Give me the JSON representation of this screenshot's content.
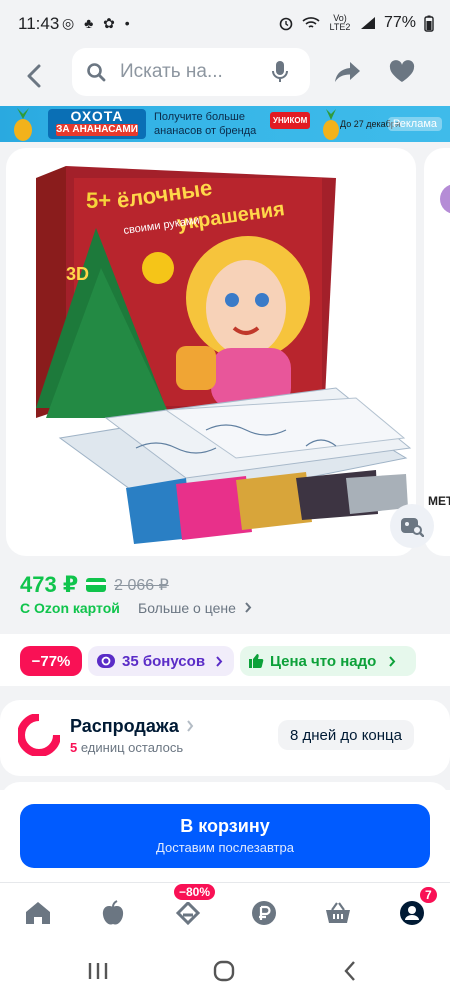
{
  "status_bar": {
    "time": "11:43",
    "left_icons": "◎ ♣ ✿ •",
    "network": "Vo) LTE2",
    "battery": "77%"
  },
  "header": {
    "search_placeholder": "Искать на..."
  },
  "banner": {
    "logo_line1": "ОХОТА",
    "logo_line2": "ЗА АНАНАСАМИ",
    "text_line1": "Получите больше",
    "text_line2": "ананасов от бренда",
    "brand": "УНИКОМ",
    "date": "До 27 декабря",
    "ad_label": "Реклама"
  },
  "product_image": {
    "box_title_line1": "ёлочные",
    "box_title_line2": "украшения",
    "box_subtitle": "своими руками",
    "age": "5+",
    "badge_3d": "3D",
    "peek_text": "МЕТ"
  },
  "price": {
    "current": "473 ₽",
    "old": "2 066 ₽",
    "ozon_card_label": "С Ozon картой",
    "more_label": "Больше о цене"
  },
  "chips": {
    "discount": "−77%",
    "bonus": "35 бонусов",
    "good_price": "Цена что надо"
  },
  "sale": {
    "title": "Распродажа",
    "units_count": "5",
    "units_text": "единиц осталось",
    "days_left": "8 дней до конца"
  },
  "cta": {
    "title": "В корзину",
    "subtitle": "Доставим послезавтра"
  },
  "bottom_nav": {
    "discount_badge": "−80%",
    "profile_badge": "7"
  },
  "colors": {
    "green": "#10c44c",
    "pink": "#f91155",
    "blue": "#005bff",
    "purple": "#5a2cc7"
  }
}
